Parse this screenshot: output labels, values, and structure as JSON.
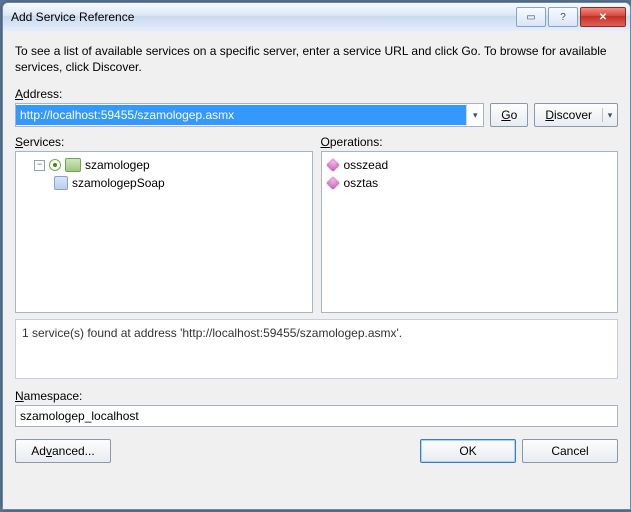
{
  "window": {
    "title": "Add Service Reference"
  },
  "intro": "To see a list of available services on a specific server, enter a service URL and click Go. To browse for available services, click Discover.",
  "address": {
    "label": "Address:",
    "value": "http://localhost:59455/szamologep.asmx",
    "go": "Go",
    "discover": "Discover"
  },
  "services": {
    "label": "Services:",
    "root": "szamologep",
    "child": "szamologepSoap"
  },
  "operations": {
    "label": "Operations:",
    "items": [
      "osszead",
      "osztas"
    ]
  },
  "status": "1 service(s) found at address 'http://localhost:59455/szamologep.asmx'.",
  "namespace": {
    "label": "Namespace:",
    "value": "szamologep_localhost"
  },
  "buttons": {
    "advanced": "Advanced...",
    "ok": "OK",
    "cancel": "Cancel"
  }
}
